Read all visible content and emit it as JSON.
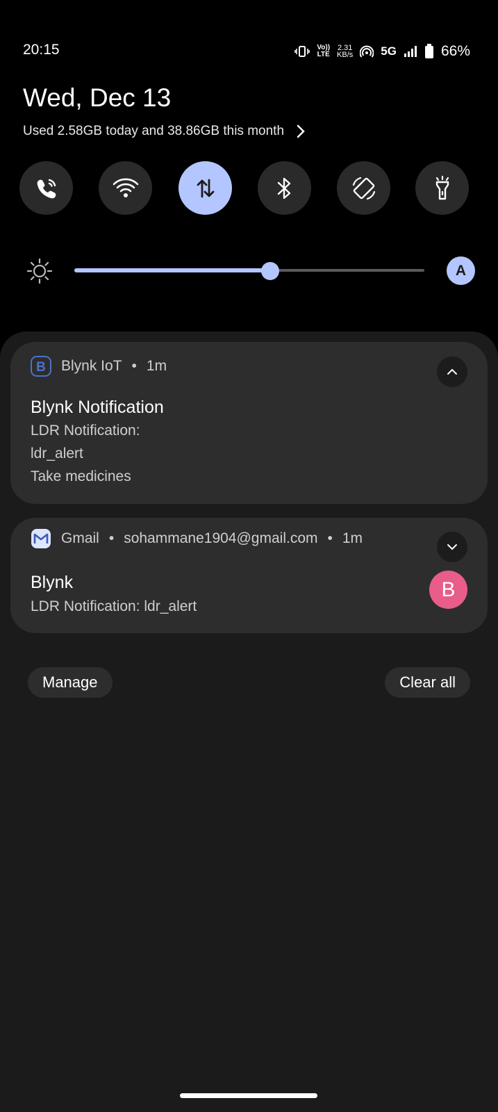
{
  "status_bar": {
    "time": "20:15",
    "volte_top": "Vo))",
    "volte_bottom": "LTE",
    "speed_value": "2.31",
    "speed_unit": "KB/s",
    "network": "5G",
    "battery": "66%"
  },
  "header": {
    "date": "Wed, Dec 13",
    "usage": "Used 2.58GB today and 38.86GB this month"
  },
  "quick_tiles": [
    {
      "name": "wifi-calling",
      "icon": "phone-wifi-icon",
      "active": false
    },
    {
      "name": "wifi",
      "icon": "wifi-icon",
      "active": false
    },
    {
      "name": "mobile-data",
      "icon": "data-arrows-icon",
      "active": true
    },
    {
      "name": "bluetooth",
      "icon": "bluetooth-icon",
      "active": false
    },
    {
      "name": "auto-rotate",
      "icon": "rotate-icon",
      "active": false
    },
    {
      "name": "flashlight",
      "icon": "flashlight-icon",
      "active": false
    }
  ],
  "brightness": {
    "level": 0.56,
    "auto_label": "A"
  },
  "notifications": [
    {
      "app": "Blynk IoT",
      "time": "1m",
      "title": "Blynk Notification",
      "lines": [
        "LDR Notification:",
        "ldr_alert",
        "Take medicines"
      ],
      "expanded": true
    },
    {
      "app": "Gmail",
      "account": "sohammane1904@gmail.com",
      "time": "1m",
      "title": "Blynk",
      "lines": [
        "LDR Notification: ldr_alert"
      ],
      "avatar": "B",
      "expanded": false
    }
  ],
  "actions": {
    "manage": "Manage",
    "clear_all": "Clear all"
  },
  "colors": {
    "accent": "#b4c6ff",
    "card": "#2d2d2d",
    "panel": "#1b1b1b",
    "avatar": "#e85d8a"
  }
}
